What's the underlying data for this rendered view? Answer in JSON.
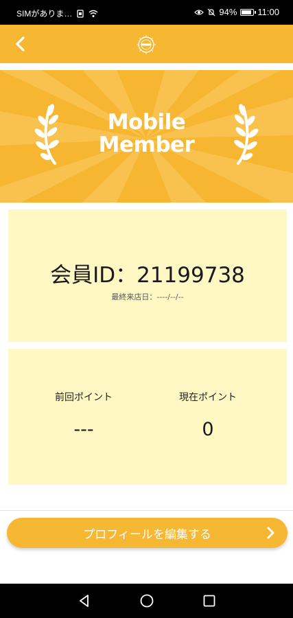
{
  "status_bar": {
    "carrier": "SIMがありま…",
    "battery": "94%",
    "battery_level": 0.94,
    "time": "11:00"
  },
  "header": {
    "back_icon": "chevron-left-icon",
    "logo_icon": "member-logo-icon"
  },
  "banner": {
    "title_line1": "Mobile",
    "title_line2": "Member"
  },
  "member": {
    "id_text": "会員ID：21199738",
    "last_visit": "最終来店日：----/--/--"
  },
  "points": {
    "previous_label": "前回ポイント",
    "previous_value": "---",
    "current_label": "現在ポイント",
    "current_value": "0"
  },
  "profile_button": {
    "label": "プロフィールを編集する",
    "icon": "chevron-right-icon"
  },
  "colors": {
    "accent": "#f6b733",
    "card_bg": "#fff8c4"
  }
}
